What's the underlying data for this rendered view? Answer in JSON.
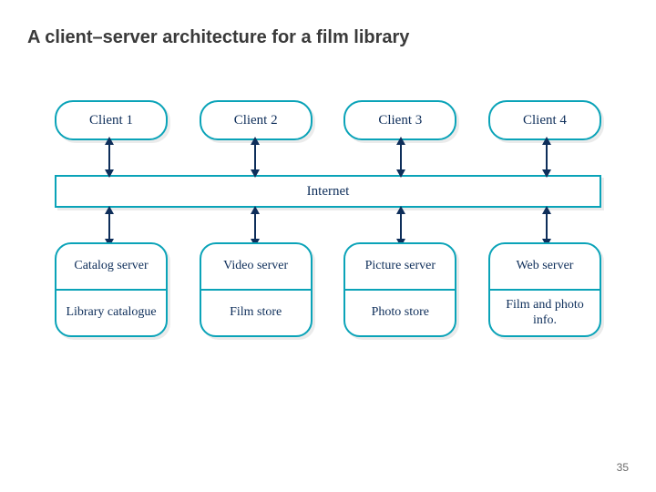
{
  "title": "A client–server architecture for a film library",
  "page_number": "35",
  "clients": [
    "Client 1",
    "Client 2",
    "Client 3",
    "Client 4"
  ],
  "middle_label": "Internet",
  "servers": [
    {
      "top": "Catalog server",
      "bottom": "Library catalogue"
    },
    {
      "top": "Video server",
      "bottom": "Film store"
    },
    {
      "top": "Picture server",
      "bottom": "Photo store"
    },
    {
      "top": "Web server",
      "bottom": "Film and photo info."
    }
  ],
  "chart_data": {
    "type": "diagram",
    "title": "A client–server architecture for a film library",
    "layers": [
      {
        "role": "clients",
        "nodes": [
          "Client 1",
          "Client 2",
          "Client 3",
          "Client 4"
        ]
      },
      {
        "role": "network",
        "nodes": [
          "Internet"
        ]
      },
      {
        "role": "servers",
        "nodes": [
          {
            "name": "Catalog server",
            "store": "Library catalogue"
          },
          {
            "name": "Video server",
            "store": "Film store"
          },
          {
            "name": "Picture server",
            "store": "Photo store"
          },
          {
            "name": "Web server",
            "store": "Film and photo info."
          }
        ]
      }
    ],
    "edges": [
      {
        "from": "Client 1",
        "to": "Internet",
        "bidirectional": true
      },
      {
        "from": "Client 2",
        "to": "Internet",
        "bidirectional": true
      },
      {
        "from": "Client 3",
        "to": "Internet",
        "bidirectional": true
      },
      {
        "from": "Client 4",
        "to": "Internet",
        "bidirectional": true
      },
      {
        "from": "Internet",
        "to": "Catalog server",
        "bidirectional": true
      },
      {
        "from": "Internet",
        "to": "Video server",
        "bidirectional": true
      },
      {
        "from": "Internet",
        "to": "Picture server",
        "bidirectional": true
      },
      {
        "from": "Internet",
        "to": "Web server",
        "bidirectional": true
      }
    ]
  }
}
